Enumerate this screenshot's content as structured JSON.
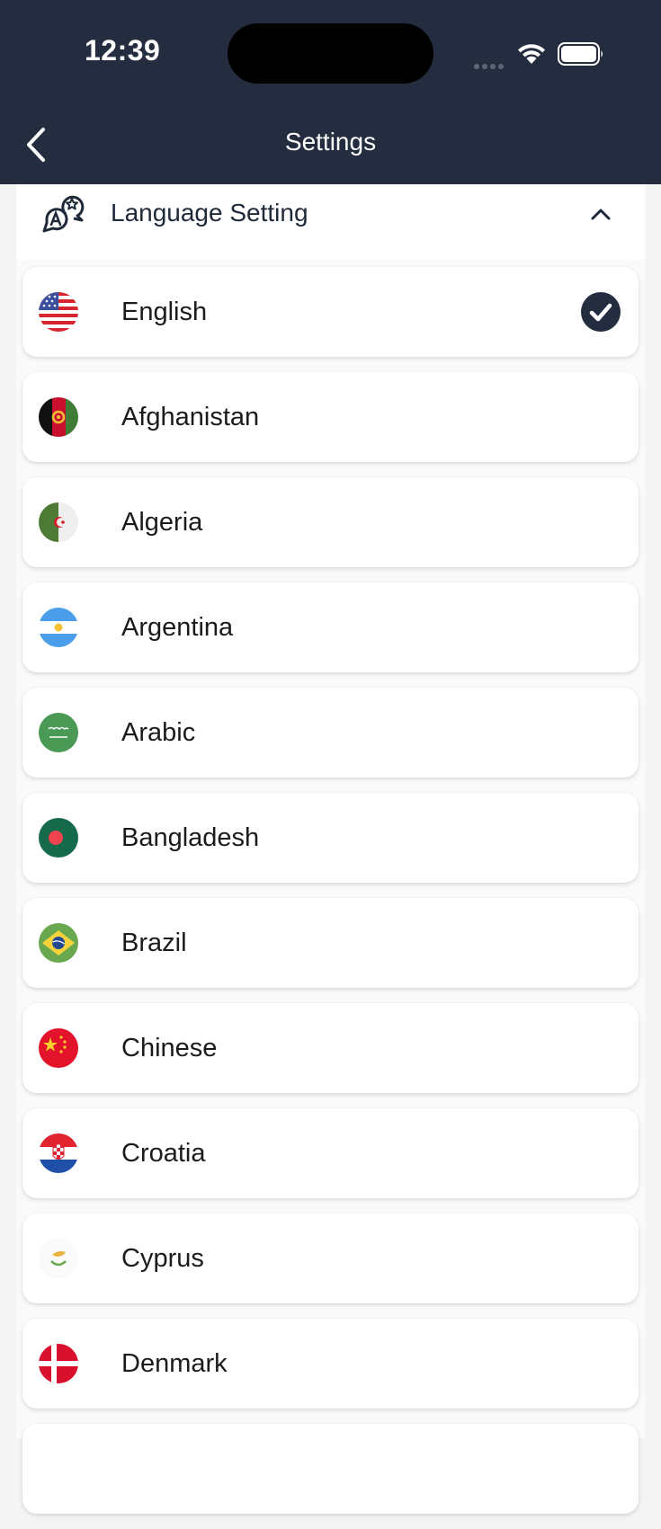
{
  "status_bar": {
    "time": "12:39"
  },
  "header": {
    "title": "Settings"
  },
  "section": {
    "title": "Language Setting"
  },
  "languages": [
    {
      "label": "English",
      "selected": true
    },
    {
      "label": "Afghanistan"
    },
    {
      "label": "Algeria"
    },
    {
      "label": "Argentina"
    },
    {
      "label": "Arabic"
    },
    {
      "label": "Bangladesh"
    },
    {
      "label": "Brazil"
    },
    {
      "label": "Chinese"
    },
    {
      "label": "Croatia"
    },
    {
      "label": "Cyprus"
    },
    {
      "label": "Denmark"
    }
  ],
  "colors": {
    "header_bg": "#242d3f",
    "check_bg": "#242d3f"
  }
}
